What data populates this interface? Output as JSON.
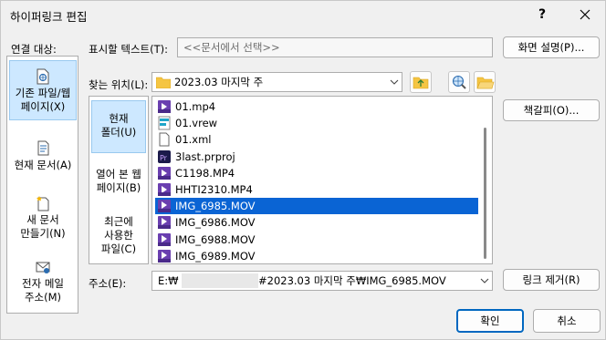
{
  "window": {
    "title": "하이퍼링크 편집",
    "help_label": "?",
    "close_label": "✕"
  },
  "link_target": {
    "label": "연결 대상:",
    "items": [
      {
        "label_line1": "기존 파일/웹",
        "label_line2": "페이지(X)",
        "icon": "existing-file-icon",
        "active": true
      },
      {
        "label_line1": "현재 문서(A)",
        "label_line2": "",
        "icon": "current-document-icon",
        "active": false
      },
      {
        "label_line1": "새 문서",
        "label_line2": "만들기(N)",
        "icon": "new-document-icon",
        "active": false
      },
      {
        "label_line1": "전자 메일",
        "label_line2": "주소(M)",
        "icon": "email-icon",
        "active": false
      }
    ]
  },
  "display_text": {
    "label": "표시할 텍스트(T):",
    "value": "<<문서에서 선택>>"
  },
  "screen_tip_button": "화면 설명(P)...",
  "look_in": {
    "label": "찾는 위치(L):",
    "value": "2023.03 마지막 주"
  },
  "browse_panel": {
    "items": [
      {
        "line1": "현재",
        "line2": "폴더(U)",
        "active": true
      },
      {
        "line1": "열어 본 웹",
        "line2": "페이지(B)",
        "active": false
      },
      {
        "line1": "최근에",
        "line2": "사용한",
        "line3": "파일(C)",
        "active": false
      }
    ]
  },
  "files": [
    {
      "name": "01.mp4",
      "icon": "mp4-file-icon",
      "selected": false
    },
    {
      "name": "01.vrew",
      "icon": "vrew-file-icon",
      "selected": false
    },
    {
      "name": "01.xml",
      "icon": "xml-file-icon",
      "selected": false
    },
    {
      "name": "3last.prproj",
      "icon": "premiere-file-icon",
      "selected": false
    },
    {
      "name": "C1198.MP4",
      "icon": "mp4-file-icon",
      "selected": false
    },
    {
      "name": "HHTI2310.MP4",
      "icon": "mp4-file-icon",
      "selected": false
    },
    {
      "name": "IMG_6985.MOV",
      "icon": "mov-file-icon",
      "selected": true
    },
    {
      "name": "IMG_6986.MOV",
      "icon": "mov-file-icon",
      "selected": false
    },
    {
      "name": "IMG_6988.MOV",
      "icon": "mov-file-icon",
      "selected": false
    },
    {
      "name": "IMG_6989.MOV",
      "icon": "mov-file-icon",
      "selected": false
    }
  ],
  "bookmark_button": "책갈피(O)...",
  "address": {
    "label": "주소(E):",
    "prefix": "E:₩",
    "suffix": "#2023.03 마지막 주₩IMG_6985.MOV"
  },
  "remove_link_button": "링크 제거(R)",
  "ok_button": "확인",
  "cancel_button": "취소",
  "colors": {
    "selection": "#0a64d4",
    "active_item": "#cde8ff",
    "primary_border": "#0067c0",
    "folder": "#f5c542"
  }
}
